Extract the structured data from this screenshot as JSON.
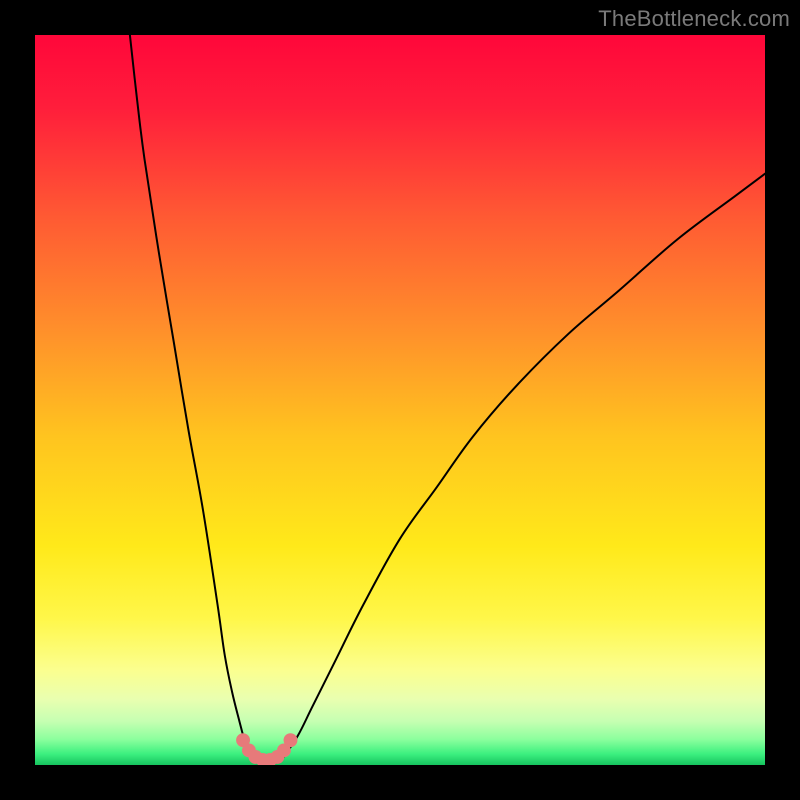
{
  "attribution": {
    "label": "TheBottleneck.com"
  },
  "chart_data": {
    "type": "line",
    "title": "",
    "xlabel": "",
    "ylabel": "",
    "legend": false,
    "axes_visible": false,
    "xlim": [
      0,
      100
    ],
    "ylim": [
      0,
      100
    ],
    "series": [
      {
        "name": "left-curve",
        "x": [
          13,
          14,
          15,
          17,
          19,
          21,
          23,
          25,
          26,
          27,
          28,
          28.8,
          29.5
        ],
        "y": [
          100,
          91,
          83,
          70,
          58,
          46,
          35,
          22,
          15,
          10,
          6,
          3,
          1
        ]
      },
      {
        "name": "valley-dots",
        "x": [
          28.5,
          29.3,
          30.2,
          31.2,
          32.2,
          33.2,
          34.1,
          35.0
        ],
        "y": [
          3.4,
          2.0,
          1.1,
          0.7,
          0.7,
          1.1,
          2.0,
          3.4
        ]
      },
      {
        "name": "right-curve",
        "x": [
          34,
          36,
          38,
          41,
          45,
          50,
          55,
          60,
          66,
          73,
          80,
          88,
          96,
          100
        ],
        "y": [
          1,
          4,
          8,
          14,
          22,
          31,
          38,
          45,
          52,
          59,
          65,
          72,
          78,
          81
        ]
      }
    ],
    "background_gradient_stops": [
      {
        "pos": 0.0,
        "color": "#ff073a"
      },
      {
        "pos": 0.1,
        "color": "#ff1e3b"
      },
      {
        "pos": 0.25,
        "color": "#ff5a33"
      },
      {
        "pos": 0.4,
        "color": "#ff8e2b"
      },
      {
        "pos": 0.55,
        "color": "#ffc41f"
      },
      {
        "pos": 0.7,
        "color": "#ffe91a"
      },
      {
        "pos": 0.8,
        "color": "#fff74a"
      },
      {
        "pos": 0.87,
        "color": "#fbff8f"
      },
      {
        "pos": 0.91,
        "color": "#e9ffb0"
      },
      {
        "pos": 0.94,
        "color": "#c6ffb2"
      },
      {
        "pos": 0.965,
        "color": "#8bff9d"
      },
      {
        "pos": 0.985,
        "color": "#3cf07f"
      },
      {
        "pos": 1.0,
        "color": "#16c45e"
      }
    ],
    "curve_color": "#000000",
    "valley_dot_color": "#e77a7a"
  }
}
